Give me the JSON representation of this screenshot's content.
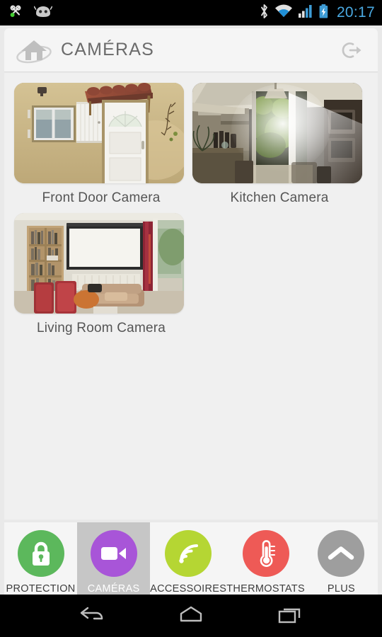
{
  "statusbar": {
    "time": "20:17",
    "left_icons": [
      {
        "name": "cyanogenmod-knot-icon"
      },
      {
        "name": "cyanogenmod-cid-icon"
      }
    ],
    "right_icons": [
      {
        "name": "bluetooth-icon"
      },
      {
        "name": "wifi-icon"
      },
      {
        "name": "cellular-signal-icon"
      },
      {
        "name": "battery-charging-icon"
      }
    ],
    "time_color": "#4aa8e0",
    "background": "#000000"
  },
  "header": {
    "title": "CAMÉRAS",
    "logo_icon": "house-orbit-logo-icon",
    "logout_icon": "logout-icon",
    "title_color": "#6b6b6b",
    "background": "#f5f5f5"
  },
  "content": {
    "background": "#f0f0f0",
    "cameras": [
      {
        "label": "Front Door Camera",
        "scene": "front-door"
      },
      {
        "label": "Kitchen Camera",
        "scene": "kitchen"
      },
      {
        "label": "Living Room Camera",
        "scene": "living-room"
      }
    ]
  },
  "tabbar": {
    "background": "#f5f5f5",
    "selected_background": "#c6c6c6",
    "tabs": [
      {
        "label": "PROTECTION",
        "icon": "lock-icon",
        "color": "#5cb85c",
        "selected": false
      },
      {
        "label": "CAMÉRAS",
        "icon": "camcorder-icon",
        "color": "#a855d8",
        "selected": true
      },
      {
        "label": "ACCESSOIRES",
        "icon": "signal-waves-icon",
        "color": "#b5d633",
        "selected": false
      },
      {
        "label": "THERMOSTATS",
        "icon": "thermometer-icon",
        "color": "#ee5a56",
        "selected": false
      },
      {
        "label": "PLUS",
        "icon": "chevron-up-icon",
        "color": "#9e9e9e",
        "selected": false
      }
    ]
  },
  "navbar": {
    "background": "#000000",
    "buttons": [
      {
        "name": "back-button",
        "icon": "back-arrow-icon"
      },
      {
        "name": "home-button",
        "icon": "home-icon"
      },
      {
        "name": "recents-button",
        "icon": "recents-icon"
      }
    ]
  }
}
